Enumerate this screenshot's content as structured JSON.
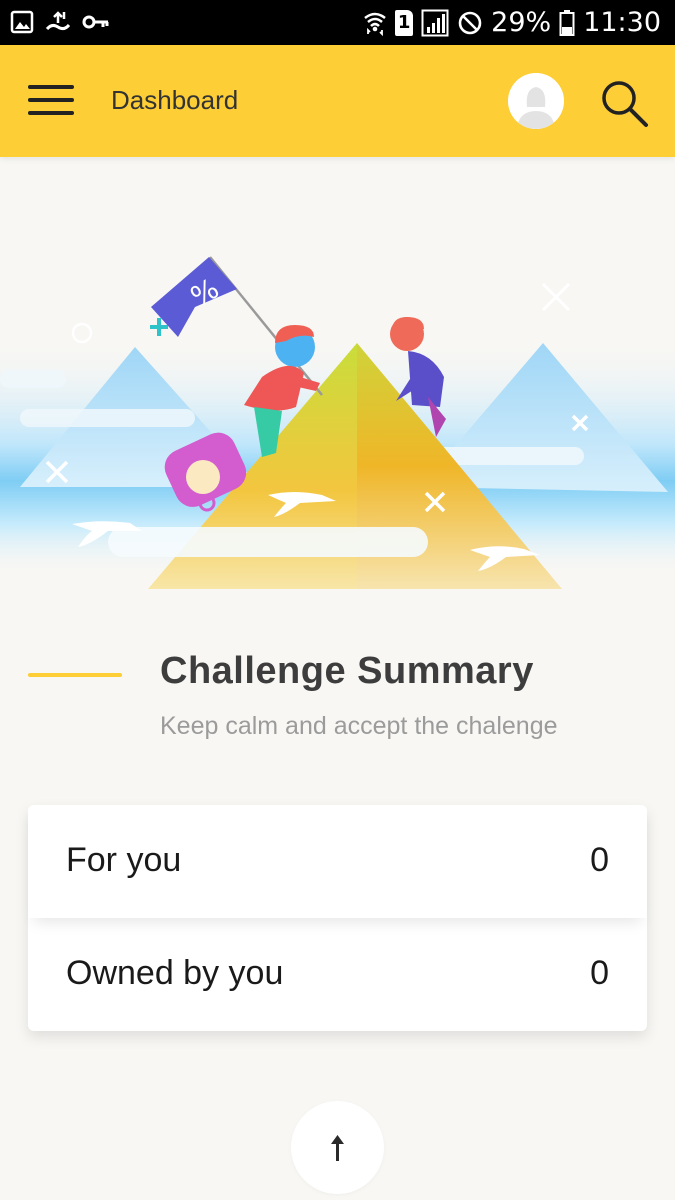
{
  "status_bar": {
    "battery": "29%",
    "time": "11:30",
    "sim_slot": "1",
    "icons": [
      "image-icon",
      "usb-icon",
      "vpn-key-icon",
      "wifi-icon",
      "sim-icon",
      "signal-icon",
      "dnd-icon",
      "battery-icon"
    ]
  },
  "app_bar": {
    "title": "Dashboard",
    "menu_icon": "hamburger-menu-icon",
    "avatar_icon": "user-avatar",
    "search_icon": "search-icon",
    "background": "#fdce36"
  },
  "hero": {
    "flag_symbol": "%"
  },
  "summary": {
    "title": "Challenge Summary",
    "subtitle": "Keep calm and accept the chalenge",
    "accent": "#fdce36",
    "rows": [
      {
        "label": "For you",
        "value": "0"
      },
      {
        "label": "Owned by you",
        "value": "0"
      }
    ]
  },
  "fab": {
    "icon": "arrow-up-icon"
  }
}
